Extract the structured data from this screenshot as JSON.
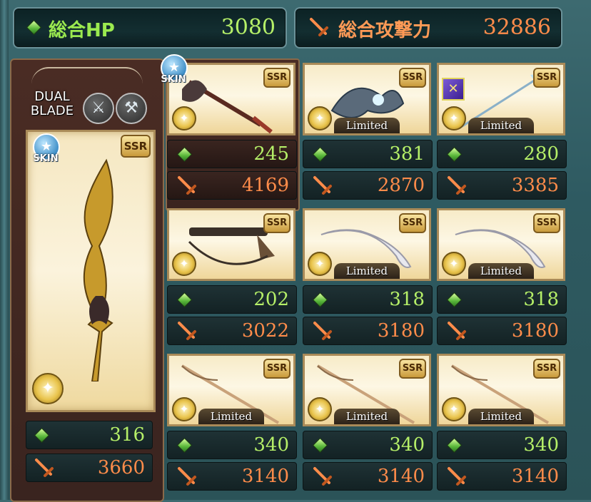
{
  "summary": {
    "hp_label": "総合HP",
    "hp_value": "3080",
    "attack_label": "総合攻撃力",
    "attack_value": "32886"
  },
  "main_weapon": {
    "specialty_label_line1": "DUAL",
    "specialty_label_line2": "BLADE",
    "specialty_icons": [
      "sword-specialty-icon",
      "axe-specialty-icon"
    ],
    "skin_badge": "SKIN",
    "rarity": "SSR",
    "hp": "316",
    "attack": "3660"
  },
  "grid": [
    {
      "rarity": "SSR",
      "limited": false,
      "skin": true,
      "limited_label": "",
      "hp": "245",
      "attack": "4169",
      "weapon": "axe"
    },
    {
      "rarity": "SSR",
      "limited": true,
      "limited_label": "Limited",
      "hp": "381",
      "attack": "2870",
      "weapon": "dragon"
    },
    {
      "rarity": "SSR",
      "limited": true,
      "limited_label": "Limited",
      "hp": "280",
      "attack": "3385",
      "weapon": "spear"
    },
    {
      "rarity": "SSR",
      "limited": false,
      "limited_label": "",
      "hp": "202",
      "attack": "3022",
      "weapon": "gun"
    },
    {
      "rarity": "SSR",
      "limited": true,
      "limited_label": "Limited",
      "hp": "318",
      "attack": "3180",
      "weapon": "scimitar"
    },
    {
      "rarity": "SSR",
      "limited": true,
      "limited_label": "Limited",
      "hp": "318",
      "attack": "3180",
      "weapon": "scimitar"
    },
    {
      "rarity": "SSR",
      "limited": true,
      "limited_label": "Limited",
      "hp": "340",
      "attack": "3140",
      "weapon": "staff"
    },
    {
      "rarity": "SSR",
      "limited": true,
      "limited_label": "Limited",
      "hp": "340",
      "attack": "3140",
      "weapon": "staff"
    },
    {
      "rarity": "SSR",
      "limited": true,
      "limited_label": "Limited",
      "hp": "340",
      "attack": "3140",
      "weapon": "staff"
    }
  ],
  "colors": {
    "hp": "#b5ef68",
    "attack": "#ff8c4a",
    "panel": "#2e5a61"
  }
}
